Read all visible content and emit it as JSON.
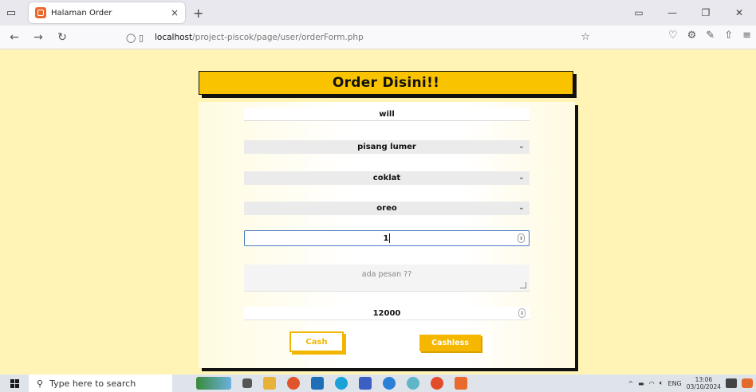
{
  "browser": {
    "tab_title": "Halaman Order",
    "tab_close": "×",
    "new_tab": "+",
    "url_host": "localhost",
    "url_path": "/project-piscok/page/user/orderForm.php"
  },
  "page": {
    "title": "Order Disini!!",
    "form": {
      "name_value": "will",
      "menu_value": "pisang lumer",
      "topping1_value": "coklat",
      "topping2_value": "oreo",
      "quantity_value": "1",
      "message_placeholder": "ada pesan ??",
      "total_value": "12000",
      "cash_label": "Cash",
      "cashless_label": "Cashless"
    }
  },
  "taskbar": {
    "search_placeholder": "Type here to search",
    "language": "ENG",
    "time": "13:06",
    "date": "03/10/2024"
  },
  "colors": {
    "page_background": "#fff4b6",
    "accent": "#f9c300",
    "focus_border": "#4a7bbf"
  }
}
